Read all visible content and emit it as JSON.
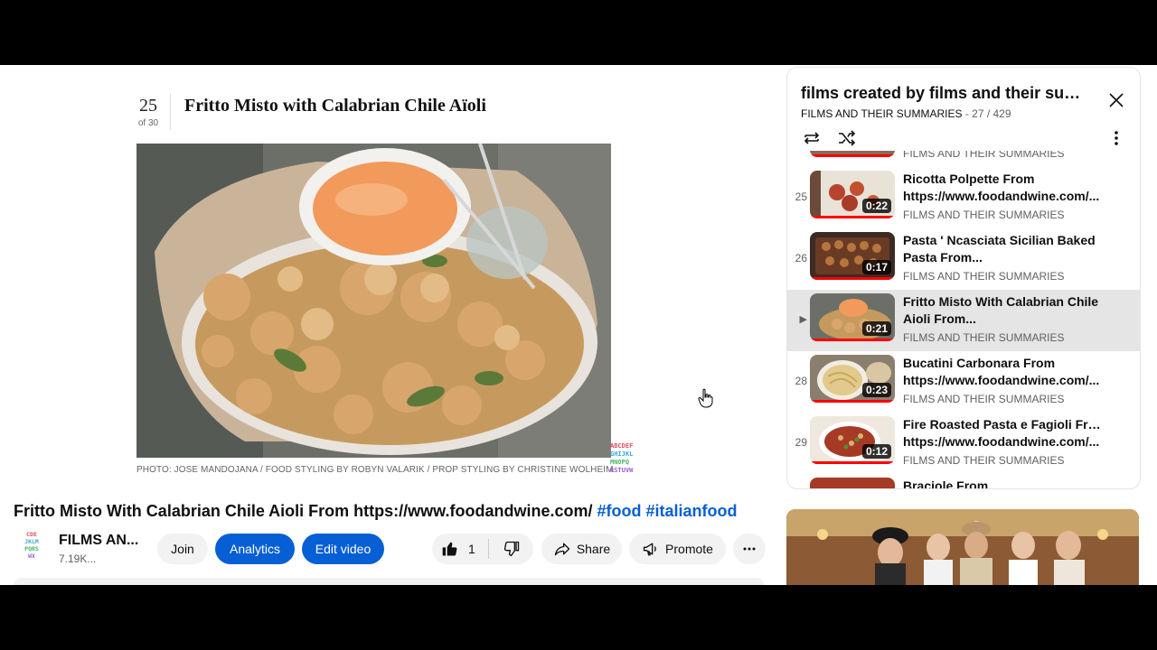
{
  "slide": {
    "number": "25",
    "of": "of 30",
    "title": "Fritto Misto with Calabrian Chile Aïoli",
    "photo_credit": "PHOTO: JOSE MANDOJANA / FOOD STYLING BY ROBYN VALARIK / PROP STYLING BY CHRISTINE WOLHEIM"
  },
  "watermark_letters": [
    "ABCDEF",
    "GHIJKLMN",
    "OPQRS",
    "TUVWXYZ"
  ],
  "video": {
    "title_text": "Fritto Misto With Calabrian Chile Aioli From https://www.foodandwine.com/ ",
    "hashtag1": "#food",
    "hashtag2": "#italianfood"
  },
  "channel": {
    "name": "FILMS AN...",
    "subscribers": "7.19K..."
  },
  "actions": {
    "join": "Join",
    "analytics": "Analytics",
    "edit_video": "Edit video",
    "like_count": "1",
    "share": "Share",
    "promote": "Promote"
  },
  "playlist": {
    "title": "films created by films and their sum...",
    "channel": "FILMS AND THEIR SUMMARIES",
    "separator": " - ",
    "position": "27 / 429",
    "partial_top_channel": "FILMS AND THEIR SUMMARIES",
    "items": [
      {
        "index": "25",
        "line1": "Ricotta Polpette From",
        "line2": "https://www.foodandwine.com/...",
        "duration": "0:22",
        "channel": "FILMS AND THEIR SUMMARIES"
      },
      {
        "index": "26",
        "line1": "Pasta ' Ncasciata Sicilian Baked",
        "line2": "Pasta From...",
        "duration": "0:17",
        "channel": "FILMS AND THEIR SUMMARIES"
      },
      {
        "index": "▶",
        "line1": "Fritto Misto With Calabrian Chile",
        "line2": "Aioli From...",
        "duration": "0:21",
        "channel": "FILMS AND THEIR SUMMARIES"
      },
      {
        "index": "28",
        "line1": "Bucatini Carbonara From",
        "line2": "https://www.foodandwine.com/...",
        "duration": "0:23",
        "channel": "FILMS AND THEIR SUMMARIES"
      },
      {
        "index": "29",
        "line1": "Fire Roasted Pasta e Fagioli From",
        "line2": "https://www.foodandwine.com/...",
        "duration": "0:12",
        "channel": "FILMS AND THEIR SUMMARIES"
      }
    ],
    "partial_bottom_title": "Braciole From"
  },
  "icons": {
    "close": "close-icon",
    "loop": "loop-icon",
    "shuffle": "shuffle-icon",
    "more": "more-vert-icon",
    "like": "thumbs-up-icon",
    "dislike": "thumbs-down-icon",
    "share": "share-icon",
    "promote": "megaphone-icon",
    "more_actions": "more-horiz-icon",
    "cursor": "hand-cursor-icon"
  },
  "colors": {
    "accent_blue": "#065fd4",
    "progress_red": "#ff0000",
    "active_row": "#e5e5e5"
  }
}
